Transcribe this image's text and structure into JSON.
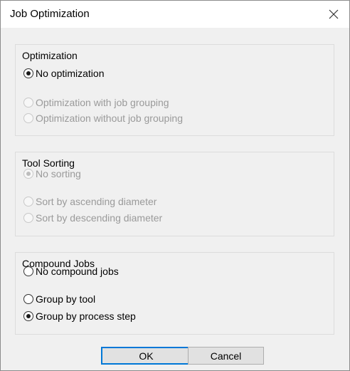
{
  "dialog": {
    "title": "Job Optimization",
    "close_icon": "close-icon"
  },
  "optimization": {
    "title": "Optimization",
    "options": [
      {
        "label": "No optimization",
        "checked": true,
        "enabled": true
      },
      {
        "label": "Optimization with job grouping",
        "checked": false,
        "enabled": false
      },
      {
        "label": "Optimization without job grouping",
        "checked": false,
        "enabled": false
      }
    ]
  },
  "tool_sorting": {
    "title": "Tool Sorting",
    "options": [
      {
        "label": "No sorting",
        "checked": true,
        "enabled": false
      },
      {
        "label": "Sort by ascending diameter",
        "checked": false,
        "enabled": false
      },
      {
        "label": "Sort by descending diameter",
        "checked": false,
        "enabled": false
      }
    ]
  },
  "compound_jobs": {
    "title": "Compound Jobs",
    "options": [
      {
        "label": "No compound jobs",
        "checked": false,
        "enabled": true
      },
      {
        "label": "Group by tool",
        "checked": false,
        "enabled": true
      },
      {
        "label": "Group by process step",
        "checked": true,
        "enabled": true
      }
    ]
  },
  "buttons": {
    "ok_label": "OK",
    "cancel_label": "Cancel"
  },
  "colors": {
    "dialog_bg": "#f0f0f0",
    "titlebar_bg": "#ffffff",
    "disabled_text": "#9a9a9a",
    "default_button_border": "#0078d7"
  }
}
